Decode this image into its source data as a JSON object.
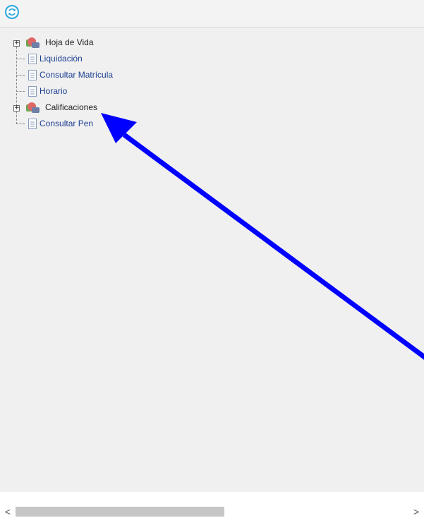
{
  "toolbar": {
    "refresh_icon": "refresh-icon"
  },
  "tree": {
    "items": [
      {
        "label": "Hoja de Vida",
        "type": "folder",
        "expandable": true,
        "expander": "+"
      },
      {
        "label": "Liquidación",
        "type": "page",
        "expandable": false
      },
      {
        "label": "Consultar Matrícula",
        "type": "page",
        "expandable": false
      },
      {
        "label": "Horario",
        "type": "page",
        "expandable": false
      },
      {
        "label": "Calificaciones",
        "type": "folder",
        "expandable": true,
        "expander": "+"
      },
      {
        "label": "Consultar Pen",
        "type": "page",
        "expandable": false
      }
    ]
  },
  "scrollbar": {
    "left_arrow": "<",
    "right_arrow": ">"
  },
  "annotation": {
    "arrow_color": "#0000ff"
  },
  "colors": {
    "link": "#1c3f91",
    "folder_text": "#222222",
    "refresh_icon": "#2aa7d6"
  }
}
